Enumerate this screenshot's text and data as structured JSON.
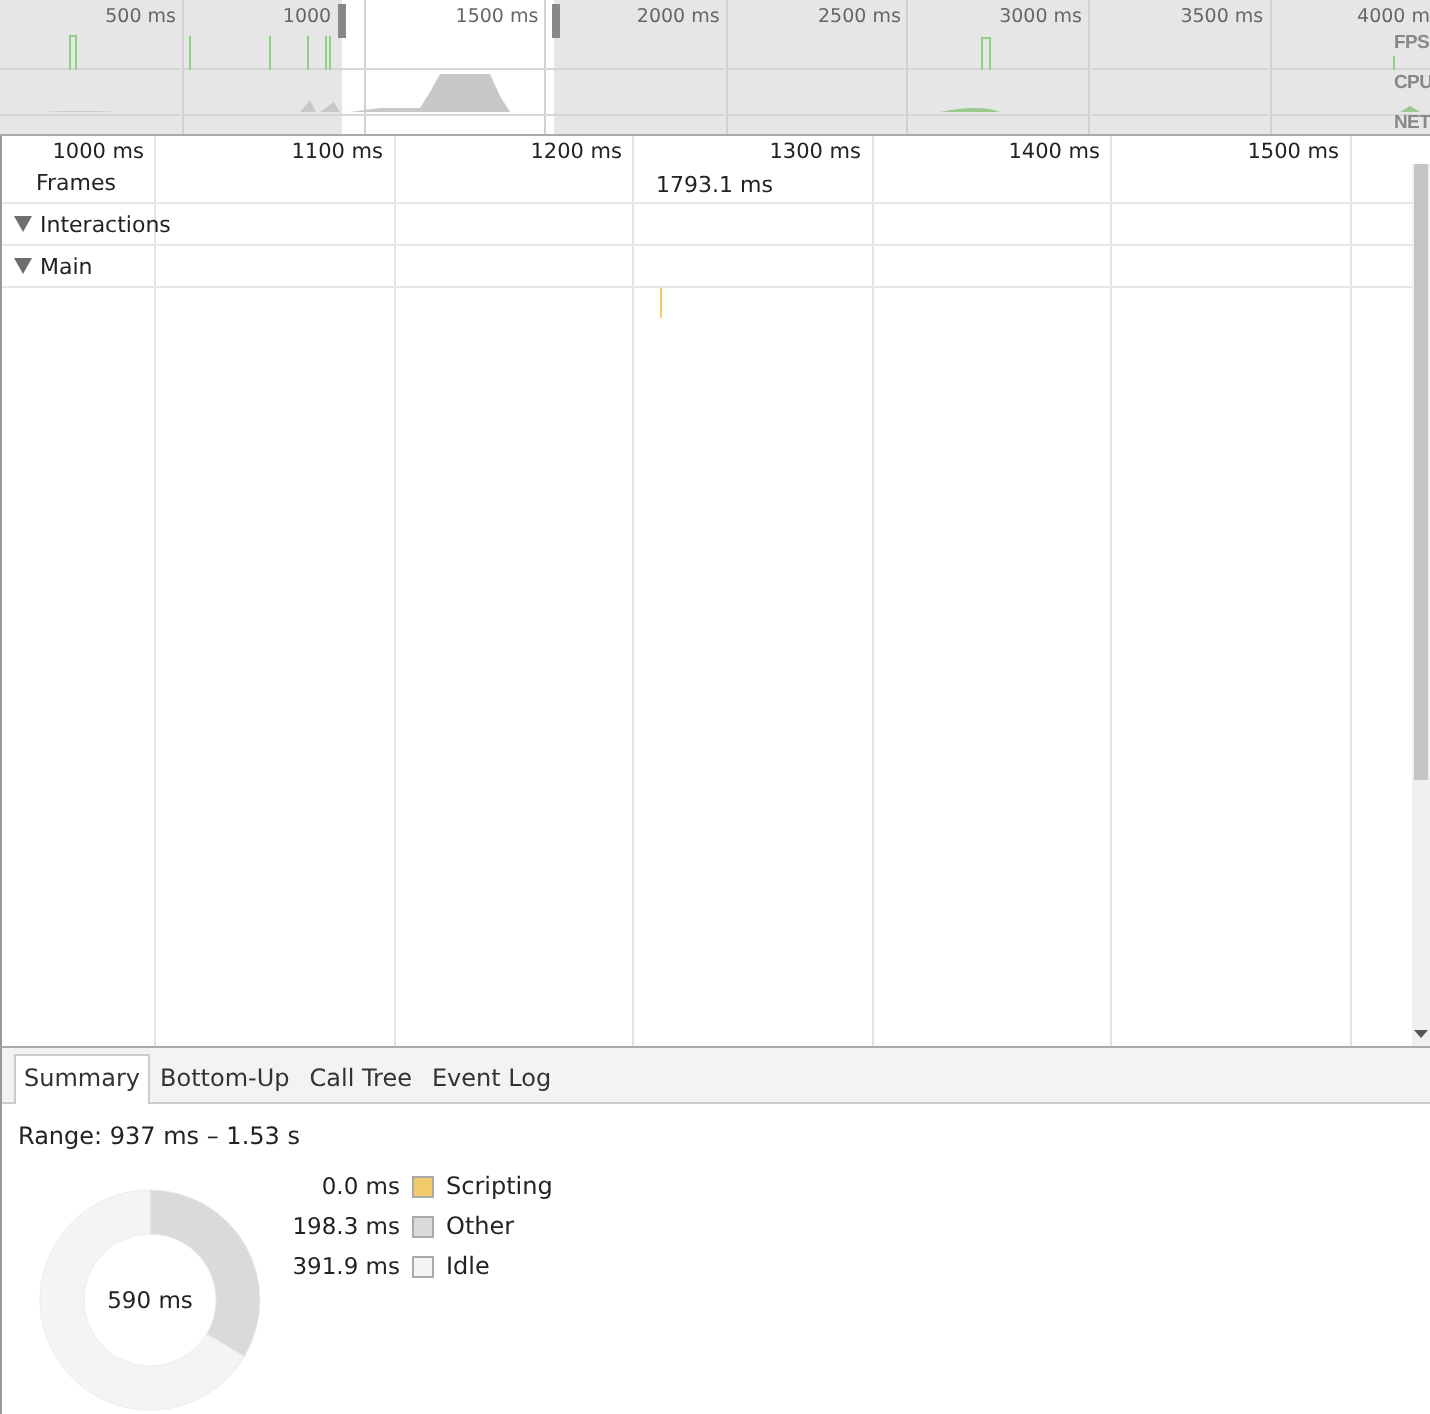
{
  "overview": {
    "ticks": [
      {
        "label": "500 ms"
      },
      {
        "label": "1000",
        "covered": true
      },
      {
        "label": "1500 ms"
      },
      {
        "label": "2000 ms"
      },
      {
        "label": "2500 ms"
      },
      {
        "label": "3000 ms"
      },
      {
        "label": "3500 ms"
      },
      {
        "label": "4000 m"
      }
    ],
    "track_labels": [
      "FPS",
      "CPU",
      "NET"
    ]
  },
  "timeline": {
    "ticks": [
      "1000 ms",
      "1100 ms",
      "1200 ms",
      "1300 ms",
      "1400 ms",
      "1500 ms"
    ],
    "tracks": [
      {
        "label": "Frames",
        "kind": "frames",
        "value": "1793.1 ms"
      },
      {
        "label": "Interactions",
        "kind": "group",
        "expanded": true
      },
      {
        "label": "Main",
        "kind": "group",
        "expanded": true
      }
    ]
  },
  "tabs": [
    {
      "label": "Summary",
      "selected": true
    },
    {
      "label": "Bottom-Up",
      "selected": false
    },
    {
      "label": "Call Tree",
      "selected": false
    },
    {
      "label": "Event Log",
      "selected": false
    }
  ],
  "summary": {
    "range": "Range: 937 ms – 1.53 s",
    "total": "590 ms",
    "legend": [
      {
        "value": "0.0 ms",
        "label": "Scripting",
        "color": "#f2cb6c"
      },
      {
        "value": "198.3 ms",
        "label": "Other",
        "color": "#dadada"
      },
      {
        "value": "391.9 ms",
        "label": "Idle",
        "color": "#f4f4f4"
      }
    ]
  }
}
